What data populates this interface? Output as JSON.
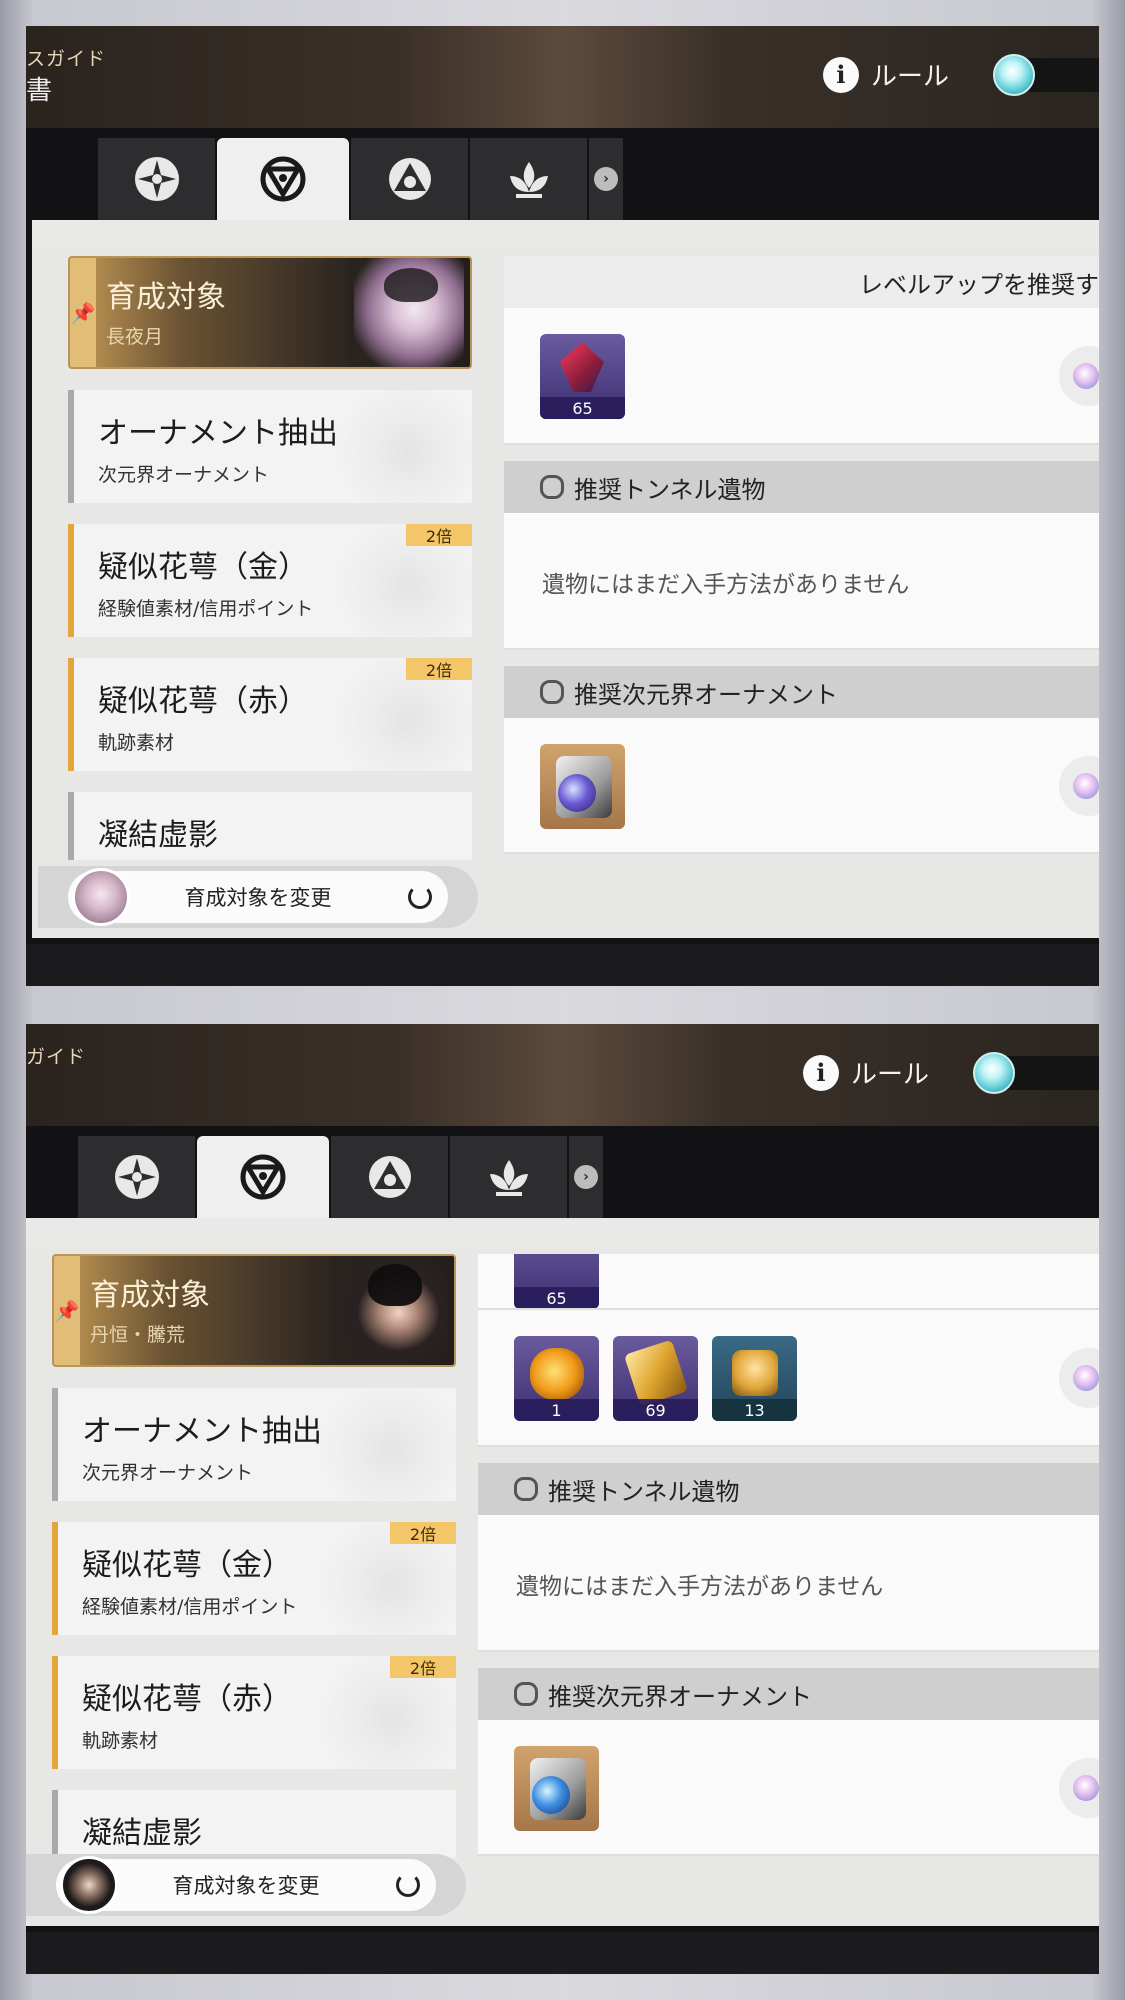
{
  "screens": [
    {
      "header": {
        "guide_label": "スガイド",
        "book_label": "書",
        "rules_label": "ルール"
      },
      "target": {
        "title": "育成対象",
        "character": "長夜月"
      },
      "list": [
        {
          "title": "オーナメント抽出",
          "subtitle": "次元界オーナメント",
          "badge": ""
        },
        {
          "title": "疑似花萼（金）",
          "subtitle": "経験値素材/信用ポイント",
          "badge": "2倍"
        },
        {
          "title": "疑似花萼（赤）",
          "subtitle": "軌跡素材",
          "badge": "2倍"
        },
        {
          "title": "凝結虚影",
          "subtitle": "",
          "badge": ""
        }
      ],
      "change_button": "育成対象を変更",
      "right": {
        "levelup_header": "レベルアップを推奨す",
        "levelup_items": [
          {
            "count": "65"
          }
        ],
        "relic_header": "推奨トンネル遺物",
        "relic_empty": "遺物にはまだ入手方法がありません",
        "ornament_header": "推奨次元界オーナメント"
      }
    },
    {
      "header": {
        "guide_label": "ガイド",
        "rules_label": "ルール"
      },
      "target": {
        "title": "育成対象",
        "character": "丹恒・騰荒"
      },
      "list": [
        {
          "title": "オーナメント抽出",
          "subtitle": "次元界オーナメント",
          "badge": ""
        },
        {
          "title": "疑似花萼（金）",
          "subtitle": "経験値素材/信用ポイント",
          "badge": "2倍"
        },
        {
          "title": "疑似花萼（赤）",
          "subtitle": "軌跡素材",
          "badge": "2倍"
        },
        {
          "title": "凝結虚影",
          "subtitle": "",
          "badge": ""
        }
      ],
      "change_button": "育成対象を変更",
      "right": {
        "top_item_count": "65",
        "materials": [
          {
            "count": "1"
          },
          {
            "count": "69"
          },
          {
            "count": "13"
          }
        ],
        "relic_header": "推奨トンネル遺物",
        "relic_empty": "遺物にはまだ入手方法がありません",
        "ornament_header": "推奨次元界オーナメント"
      }
    }
  ]
}
